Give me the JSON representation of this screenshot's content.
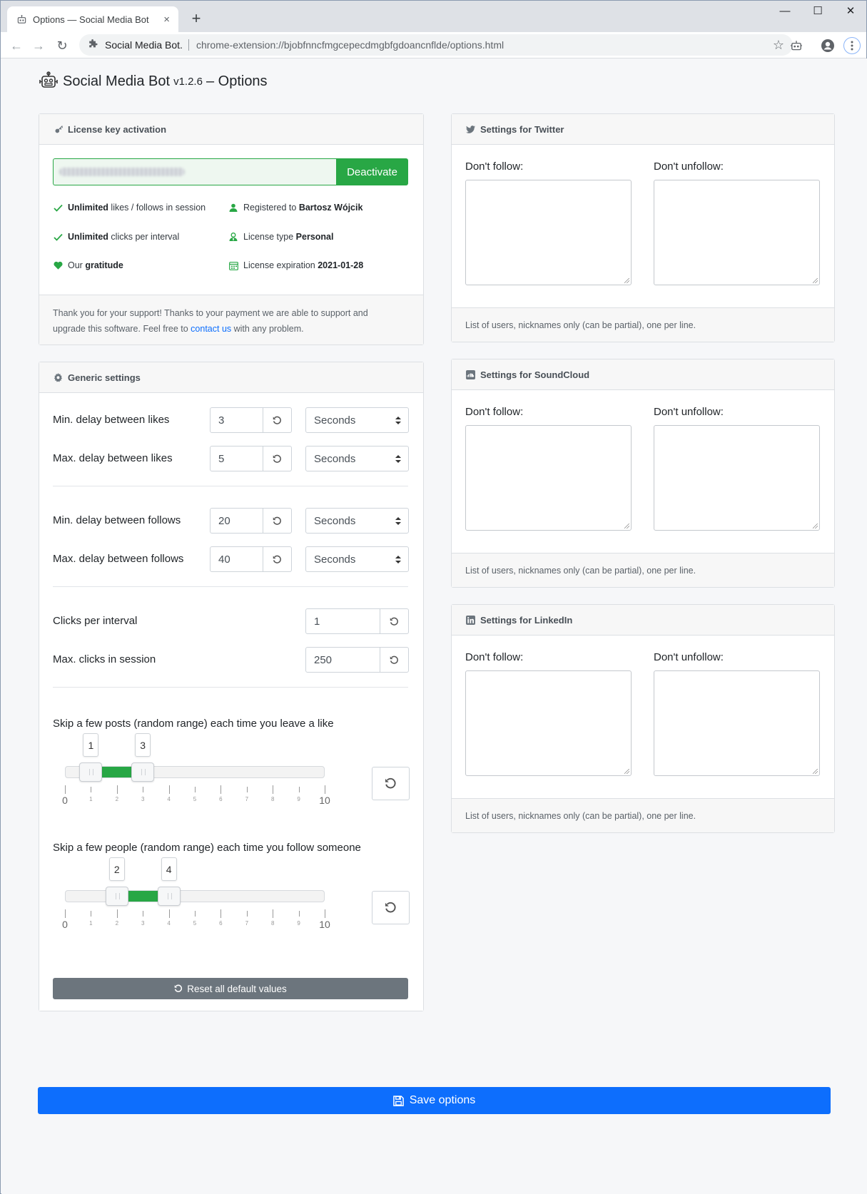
{
  "browser": {
    "tab_title": "Options — Social Media Bot",
    "tab_close": "×",
    "new_tab": "+",
    "minimize": "—",
    "maximize": "☐",
    "close": "✕",
    "back": "←",
    "forward": "→",
    "reload": "↻",
    "site_name": "Social Media Bot.",
    "url": "chrome-extension://bjobfnncfmgcepecdmgbfgdoancnflde/options.html",
    "bookmark": "☆"
  },
  "page": {
    "title": "Social Media Bot",
    "version": "v1.2.6",
    "title_suffix": "– Options"
  },
  "license": {
    "header": "License key activation",
    "deactivate_label": "Deactivate",
    "features": {
      "unlimited_likes_bold": "Unlimited",
      "unlimited_likes_rest": " likes / follows in session",
      "unlimited_clicks_bold": "Unlimited",
      "unlimited_clicks_rest": " clicks per interval",
      "gratitude_pre": "Our ",
      "gratitude_bold": "gratitude",
      "registered_pre": "Registered to ",
      "registered_name": "Bartosz Wójcik",
      "type_pre": "License type ",
      "type_value": "Personal",
      "expiration_pre": "License expiration ",
      "expiration_value": "2021-01-28"
    },
    "footer_line1": "Thank you for your support! Thanks to your payment we are able to support and",
    "footer_line2_pre": "upgrade this software. Feel free to ",
    "footer_link": "contact us",
    "footer_line2_post": " with any problem."
  },
  "generic": {
    "header": "Generic settings",
    "min_likes_label": "Min. delay between likes",
    "min_likes_value": "3",
    "min_likes_unit": "Seconds",
    "max_likes_label": "Max. delay between likes",
    "max_likes_value": "5",
    "max_likes_unit": "Seconds",
    "min_follows_label": "Min. delay between follows",
    "min_follows_value": "20",
    "min_follows_unit": "Seconds",
    "max_follows_label": "Max. delay between follows",
    "max_follows_value": "40",
    "max_follows_unit": "Seconds",
    "clicks_label": "Clicks per interval",
    "clicks_value": "1",
    "max_clicks_label": "Max. clicks in session",
    "max_clicks_value": "250",
    "skip_posts_label": "Skip a few posts (random range) each time you leave a like",
    "skip_posts_range": {
      "min": 0,
      "max": 10,
      "low": 1,
      "high": 3,
      "low_label": "1",
      "high_label": "3"
    },
    "skip_people_label": "Skip a few people (random range) each time you follow someone",
    "skip_people_range": {
      "min": 0,
      "max": 10,
      "low": 2,
      "high": 4,
      "low_label": "2",
      "high_label": "4"
    },
    "scale_labels": [
      "0",
      "1",
      "2",
      "3",
      "4",
      "5",
      "6",
      "7",
      "8",
      "9",
      "10"
    ],
    "reset_all_label": "Reset all default values"
  },
  "twitter": {
    "header": "Settings for Twitter",
    "dont_follow": "Don't follow:",
    "dont_unfollow": "Don't unfollow:",
    "footer": "List of users, nicknames only (can be partial), one per line."
  },
  "soundcloud": {
    "header": "Settings for SoundCloud",
    "dont_follow": "Don't follow:",
    "dont_unfollow": "Don't unfollow:",
    "footer": "List of users, nicknames only (can be partial), one per line."
  },
  "linkedin": {
    "header": "Settings for LinkedIn",
    "dont_follow": "Don't follow:",
    "dont_unfollow": "Don't unfollow:",
    "footer": "List of users, nicknames only (can be partial), one per line."
  },
  "save_label": "Save options",
  "colors": {
    "success": "#28a745",
    "primary": "#0d6efd",
    "secondary": "#6c757d"
  }
}
